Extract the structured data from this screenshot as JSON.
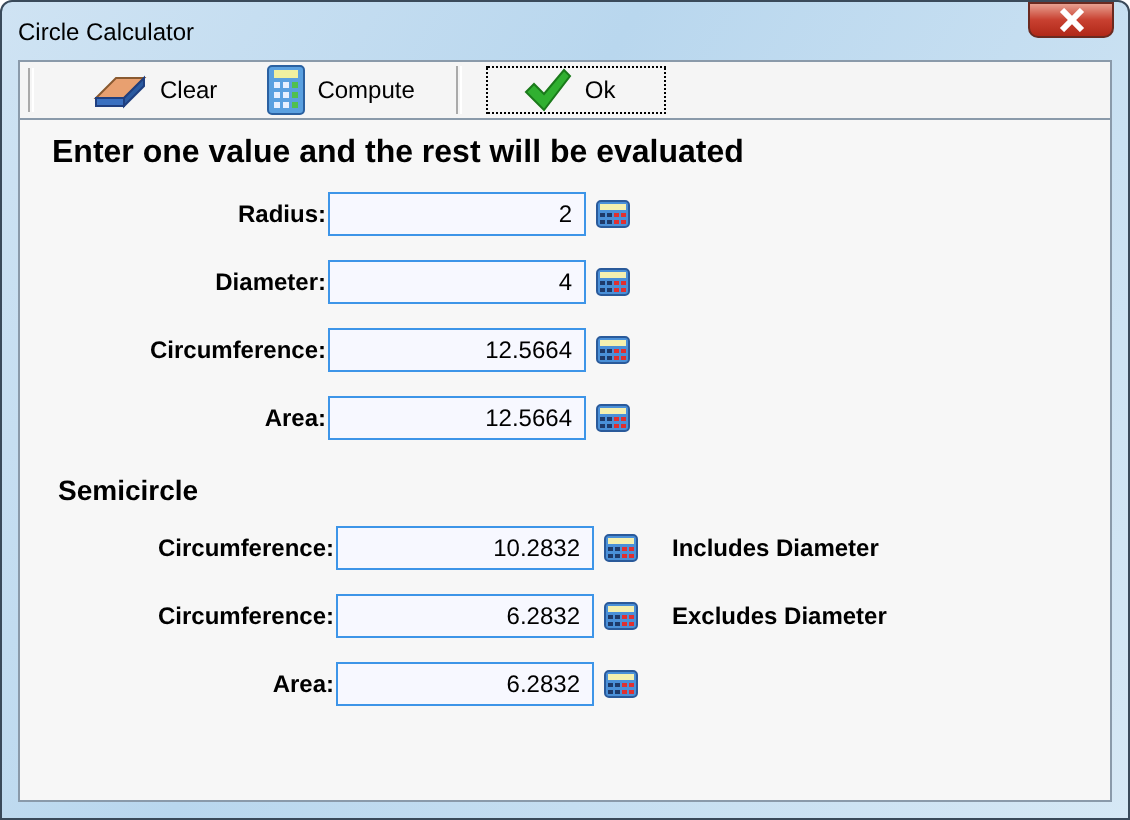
{
  "window": {
    "title": "Circle Calculator"
  },
  "toolbar": [
    {
      "label": "Clear",
      "kind": "eraser",
      "focused": false
    },
    {
      "label": "Compute",
      "kind": "calculator",
      "focused": false
    },
    {
      "label": "Ok",
      "kind": "check",
      "focused": true
    }
  ],
  "heading": "Enter one value and the rest will be evaluated",
  "circle_fields": [
    {
      "label": "Radius:",
      "value": "2"
    },
    {
      "label": "Diameter:",
      "value": "4"
    },
    {
      "label": "Circumference:",
      "value": "12.5664"
    },
    {
      "label": "Area:",
      "value": "12.5664"
    }
  ],
  "semicircle": {
    "heading": "Semicircle",
    "fields": [
      {
        "label": "Circumference:",
        "value": "10.2832",
        "note": "Includes Diameter"
      },
      {
        "label": "Circumference:",
        "value": "6.2832",
        "note": "Excludes Diameter"
      },
      {
        "label": "Area:",
        "value": "6.2832"
      }
    ]
  }
}
